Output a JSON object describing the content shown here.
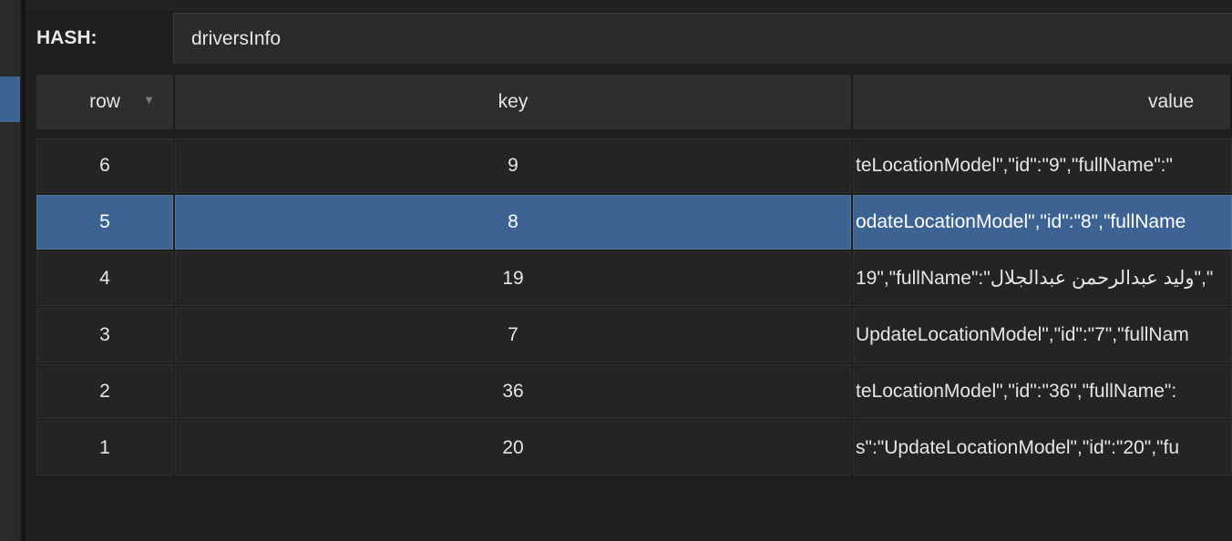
{
  "hash": {
    "label": "HASH:",
    "value": "driversInfo"
  },
  "table": {
    "columns": [
      {
        "label": "row"
      },
      {
        "label": "key"
      },
      {
        "label": "value"
      }
    ],
    "rows": [
      {
        "row": "6",
        "key": "9",
        "value": "teLocationModel\",\"id\":\"9\",\"fullName\":\"",
        "selected": false
      },
      {
        "row": "5",
        "key": "8",
        "value": "odateLocationModel\",\"id\":\"8\",\"fullName",
        "selected": true
      },
      {
        "row": "4",
        "key": "19",
        "value": "19\",\"fullName\":\"وليد عبدالرحمن عبدالجلال\",\"",
        "selected": false
      },
      {
        "row": "3",
        "key": "7",
        "value": "UpdateLocationModel\",\"id\":\"7\",\"fullNam",
        "selected": false
      },
      {
        "row": "2",
        "key": "36",
        "value": "teLocationModel\",\"id\":\"36\",\"fullName\":",
        "selected": false
      },
      {
        "row": "1",
        "key": "20",
        "value": "s\":\"UpdateLocationModel\",\"id\":\"20\",\"fu",
        "selected": false
      }
    ]
  },
  "icons": {
    "sort": "sort-descending-icon"
  },
  "colors": {
    "selection": "#3d6392",
    "background": "#1e1e1e"
  }
}
